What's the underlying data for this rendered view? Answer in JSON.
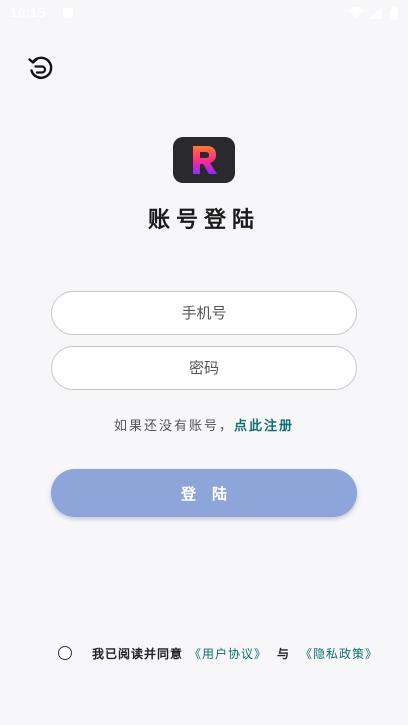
{
  "status_bar": {
    "time": "10:15"
  },
  "page": {
    "title": "账号登陆"
  },
  "form": {
    "phone_placeholder": "手机号",
    "password_placeholder": "密码",
    "register_prompt": "如果还没有账号，",
    "register_link": "点此注册",
    "login_label": "登陆"
  },
  "agreement": {
    "prefix": "我已阅读并同意",
    "user_agreement": "《用户协议》",
    "and": "与",
    "privacy_policy": "《隐私政策》"
  },
  "colors": {
    "accent_link": "#0f6f73",
    "login_button": "#8ea5d9",
    "background": "#f7f6f9"
  }
}
